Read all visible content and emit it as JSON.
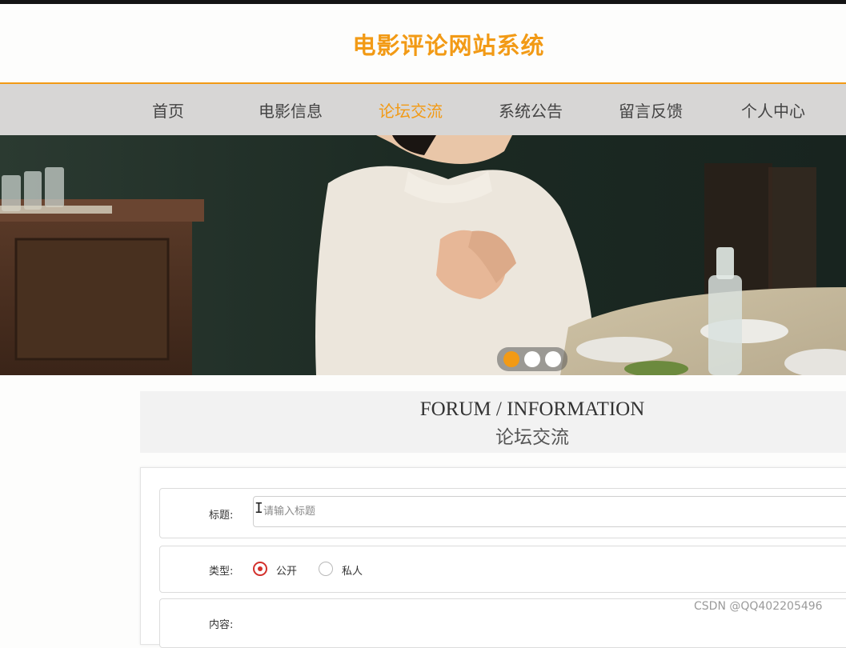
{
  "site": {
    "title": "电影评论网站系统",
    "accent_color": "#f29a15"
  },
  "nav": {
    "items": [
      {
        "label": "首页",
        "active": false
      },
      {
        "label": "电影信息",
        "active": false
      },
      {
        "label": "论坛交流",
        "active": true
      },
      {
        "label": "系统公告",
        "active": false
      },
      {
        "label": "留言反馈",
        "active": false
      },
      {
        "label": "个人中心",
        "active": false
      }
    ]
  },
  "banner": {
    "slides": 3,
    "active_slide": 1
  },
  "section": {
    "title_en": "FORUM / INFORMATION",
    "title_cn": "论坛交流"
  },
  "form": {
    "title_label": "标题:",
    "title_placeholder": "请输入标题",
    "type_label": "类型:",
    "type_options": [
      {
        "label": "公开",
        "checked": true
      },
      {
        "label": "私人",
        "checked": false
      }
    ],
    "content_label": "内容:"
  },
  "watermark": "CSDN @QQ402205496"
}
